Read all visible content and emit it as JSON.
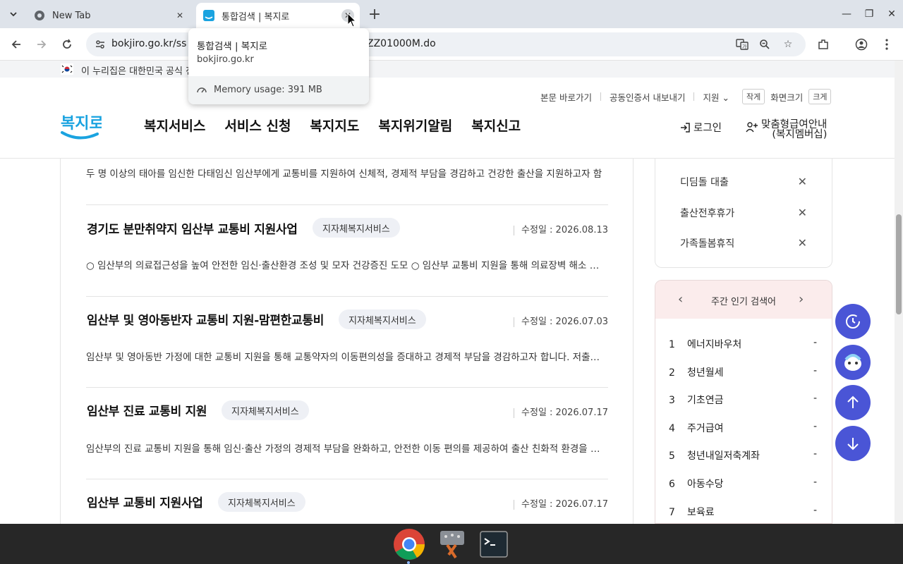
{
  "browser": {
    "tabs": [
      {
        "title": "New Tab"
      },
      {
        "title": "통합검색 | 복지로"
      }
    ],
    "url_left": "bokjiro.go.kr/ss",
    "url_right": "ZZ01000M.do",
    "tooltip": {
      "title": "통합검색 | 복지로",
      "domain": "bokjiro.go.kr",
      "memory": "Memory usage: 391 MB"
    }
  },
  "gov_banner": "이 누리집은 대한민국 공식 전",
  "header": {
    "util": {
      "skip": "본문 바로가기",
      "cert": "공동인증서 내보내기",
      "region": "지원",
      "small": "작게",
      "zoom": "화면크기",
      "large": "크게"
    },
    "gnb": [
      "복지서비스",
      "서비스 신청",
      "복지지도",
      "복지위기알림",
      "복지신고"
    ],
    "login": "로그인",
    "custom_line1": "맞춤형급여안내",
    "custom_line2": "(복지멤버십)"
  },
  "results": {
    "top_desc": "두 명 이상의 태아를 임신한 다태임신 임산부에게 교통비를 지원하여 신체적, 경제적 부담을 경감하고 건강한 출산을 지원하고자 함",
    "items": [
      {
        "title": "경기도 분만취약지 임산부 교통비 지원사업",
        "badge": "지자체복지서비스",
        "date": "수정일 : 2026.08.13",
        "desc": "○ 임산부의 의료접근성을 높여 안전한 임신·출산환경 조성 및 모자 건강증진 도모 ○ 임산부 교통비 지원을 통해 의료장벽 해소 및 …"
      },
      {
        "title": "임산부 및 영아동반자 교통비 지원-맘편한교통비",
        "badge": "지자체복지서비스",
        "date": "수정일 : 2026.07.03",
        "desc": "임산부 및 영아동반 가정에 대한 교통비 지원을 통해 교통약자의 이동편의성을 증대하고 경제적 부담을 경감하고자 합니다. 저출산 …"
      },
      {
        "title": "임산부 진료 교통비 지원",
        "badge": "지자체복지서비스",
        "date": "수정일 : 2026.07.17",
        "desc": "임산부의 진료 교통비 지원을 통해 임신·출산 가정의 경제적 부담을 완화하고, 안전한 이동 편의를 제공하여 출산 친화적 환경을 조…"
      },
      {
        "title": "임산부 교통비 지원사업",
        "badge": "지자체복지서비스",
        "date": "수정일 : 2026.07.17",
        "desc": ""
      }
    ]
  },
  "recent": [
    "디딤돌 대출",
    "출산전후휴가",
    "가족돌봄휴직"
  ],
  "popular": {
    "title": "주간 인기 검색어",
    "items": [
      {
        "rank": "1",
        "term": "에너지바우처",
        "change": "-"
      },
      {
        "rank": "2",
        "term": "청년월세",
        "change": "-"
      },
      {
        "rank": "3",
        "term": "기초연금",
        "change": "-"
      },
      {
        "rank": "4",
        "term": "주거급여",
        "change": "-"
      },
      {
        "rank": "5",
        "term": "청년내일저축계좌",
        "change": "-"
      },
      {
        "rank": "6",
        "term": "아동수당",
        "change": "-"
      },
      {
        "rank": "7",
        "term": "보육료",
        "change": "-"
      }
    ]
  },
  "colors": {
    "brand_blue": "#4a55d6",
    "logo_blue": "#1aa3e0",
    "popular_bg": "#fbecec"
  }
}
